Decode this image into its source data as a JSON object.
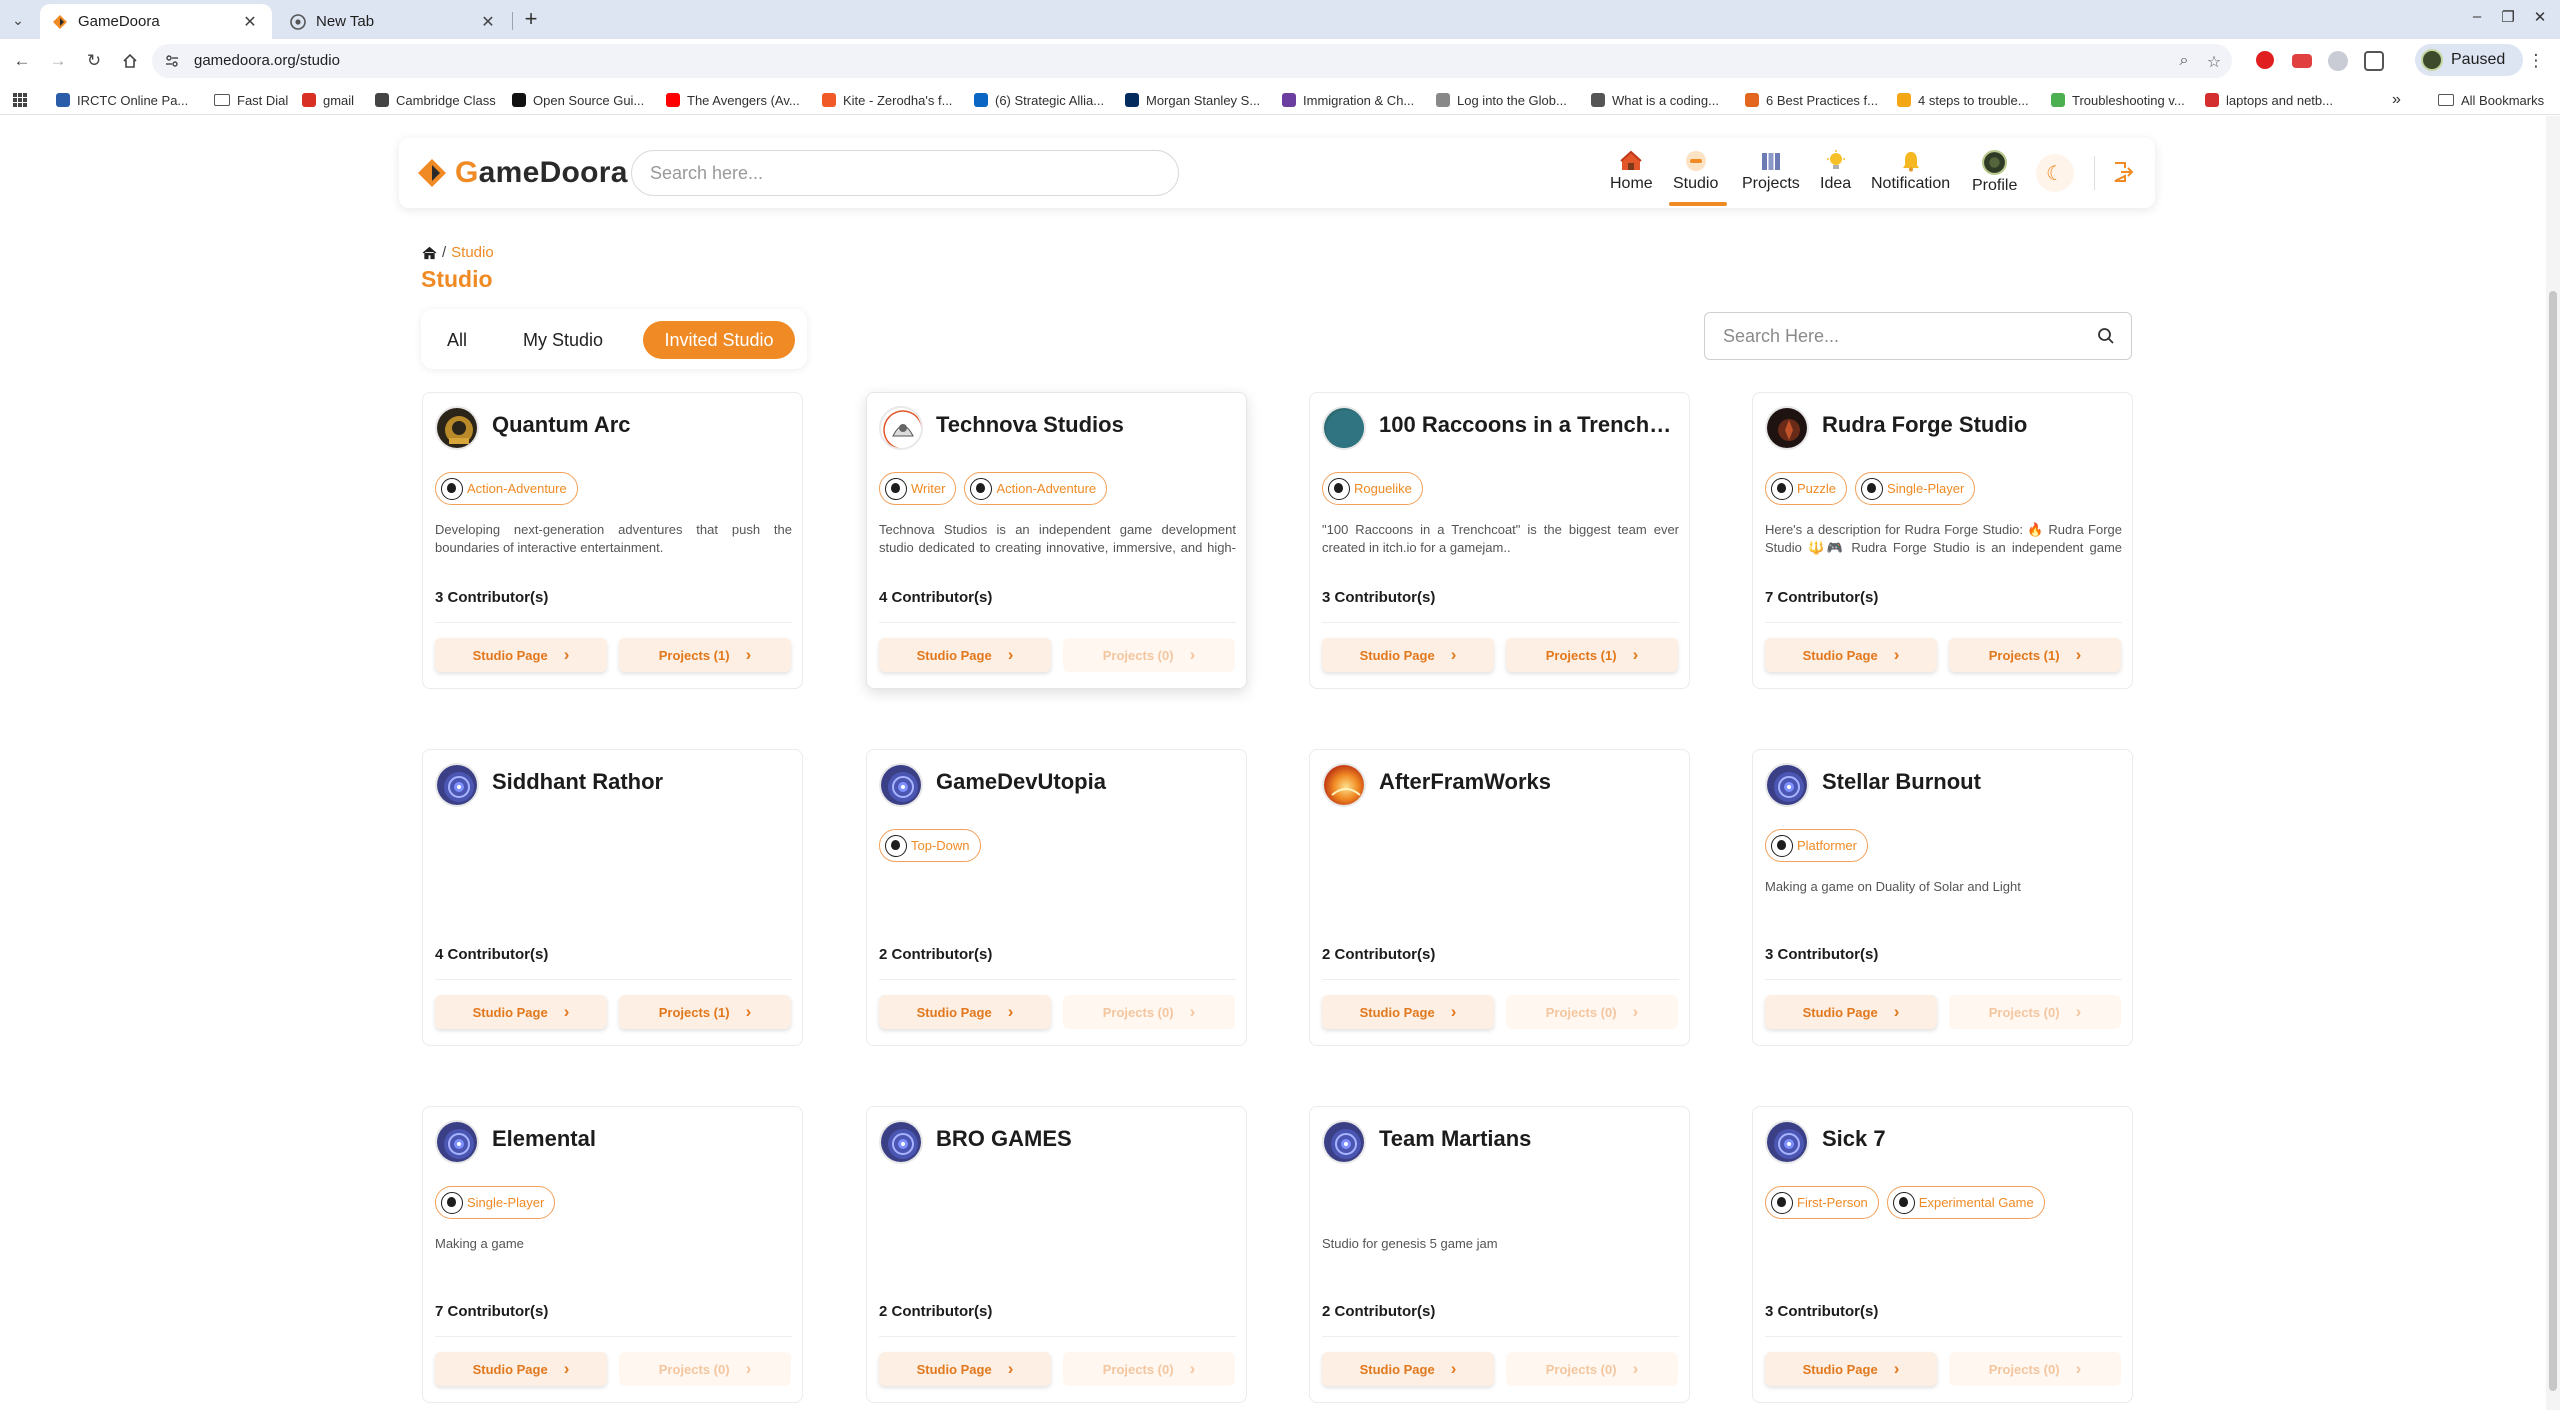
{
  "browser": {
    "tabs": [
      {
        "title": "GameDoora",
        "active": true
      },
      {
        "title": "New Tab",
        "active": false
      }
    ],
    "url": "gamedoora.org/studio",
    "profile_status": "Paused",
    "bookmarks": [
      {
        "label": "IRCTC Online Pa...",
        "color": "#2a5caa"
      },
      {
        "label": "Fast Dial",
        "folder": true
      },
      {
        "label": "gmail",
        "color": "#d93025"
      },
      {
        "label": "Cambridge Class",
        "color": "#444444"
      },
      {
        "label": "Open Source Gui...",
        "color": "#111111"
      },
      {
        "label": "The Avengers (Av...",
        "color": "#ff0000"
      },
      {
        "label": "Kite - Zerodha's f...",
        "color": "#f05a28"
      },
      {
        "label": "(6) Strategic Allia...",
        "color": "#0a66c2"
      },
      {
        "label": "Morgan Stanley S...",
        "color": "#002b5c"
      },
      {
        "label": "Immigration & Ch...",
        "color": "#6b3fa0"
      },
      {
        "label": "Log into the Glob...",
        "color": "#888888"
      },
      {
        "label": "What is a coding...",
        "color": "#555555"
      },
      {
        "label": "6 Best Practices f...",
        "color": "#e2661d"
      },
      {
        "label": "4 steps to trouble...",
        "color": "#f3a712"
      },
      {
        "label": "Troubleshooting v...",
        "color": "#4caf50"
      },
      {
        "label": "laptops and netb...",
        "color": "#d32f2f"
      }
    ],
    "all_bookmarks": "All Bookmarks"
  },
  "header": {
    "logo_text_accent": "G",
    "logo_text_rest": "ameDoora",
    "search_placeholder": "Search here...",
    "nav": [
      {
        "label": "Home",
        "icon": "home-icon"
      },
      {
        "label": "Studio",
        "icon": "studio-icon",
        "active": true
      },
      {
        "label": "Projects",
        "icon": "projects-icon"
      },
      {
        "label": "Idea",
        "icon": "idea-icon"
      },
      {
        "label": "Notification",
        "icon": "notification-icon"
      },
      {
        "label": "Profile",
        "icon": "profile-icon"
      }
    ]
  },
  "breadcrumb": {
    "separator": "/",
    "current": "Studio"
  },
  "page_title": "Studio",
  "filters": [
    {
      "label": "All",
      "active": false
    },
    {
      "label": "My Studio",
      "active": false
    },
    {
      "label": "Invited Studio",
      "active": true
    }
  ],
  "studio_search_placeholder": "Search Here...",
  "colors": {
    "accent": "#f08a24"
  },
  "studios": [
    {
      "name": "Quantum Arc",
      "tags": [
        "Action-Adventure"
      ],
      "description": "Developing next-generation adventures that push the boundaries of interactive entertainment.",
      "contributors": "3 Contributor(s)",
      "studio_page": "Studio Page",
      "projects": "Projects (1)",
      "projects_enabled": true,
      "avatar": "dark-gold"
    },
    {
      "name": "Technova Studios",
      "tags": [
        "Writer",
        "Action-Adventure"
      ],
      "description": "Technova Studios is an independent game development studio dedicated to creating innovative, immersive, and high-quality gaming experiences for players around the worl...",
      "contributors": "4 Contributor(s)",
      "studio_page": "Studio Page",
      "projects": "Projects (0)",
      "projects_enabled": false,
      "avatar": "white-sketch"
    },
    {
      "name": "100 Raccoons in a Trenchc...",
      "tags": [
        "Roguelike"
      ],
      "description": "\"100 Raccoons in a Trenchcoat\" is the biggest team ever created in itch.io for a gamejam..",
      "contributors": "3 Contributor(s)",
      "studio_page": "Studio Page",
      "projects": "Projects (1)",
      "projects_enabled": true,
      "avatar": "teal"
    },
    {
      "name": "Rudra Forge Studio",
      "tags": [
        "Puzzle",
        "Single-Player"
      ],
      "description": "Here's a description for Rudra Forge Studio: 🔥 Rudra Forge Studio 🔱🎮 Rudra Forge Studio is an independent game development studio inspired by the power, creativity, a...",
      "contributors": "7 Contributor(s)",
      "studio_page": "Studio Page",
      "projects": "Projects (1)",
      "projects_enabled": true,
      "avatar": "dark-red"
    },
    {
      "name": "Siddhant Rathor",
      "tags": [],
      "description": "",
      "contributors": "4 Contributor(s)",
      "studio_page": "Studio Page",
      "projects": "Projects (1)",
      "projects_enabled": true,
      "avatar": "default"
    },
    {
      "name": "GameDevUtopia",
      "tags": [
        "Top-Down"
      ],
      "description": "",
      "contributors": "2 Contributor(s)",
      "studio_page": "Studio Page",
      "projects": "Projects (0)",
      "projects_enabled": false,
      "avatar": "default"
    },
    {
      "name": "AfterFramWorks",
      "tags": [],
      "description": "",
      "contributors": "2 Contributor(s)",
      "studio_page": "Studio Page",
      "projects": "Projects (0)",
      "projects_enabled": false,
      "avatar": "fire"
    },
    {
      "name": "Stellar Burnout",
      "tags": [
        "Platformer"
      ],
      "description": "Making a game on Duality of Solar and Light",
      "contributors": "3 Contributor(s)",
      "studio_page": "Studio Page",
      "projects": "Projects (0)",
      "projects_enabled": false,
      "avatar": "default"
    },
    {
      "name": "Elemental",
      "tags": [
        "Single-Player"
      ],
      "description": "Making a game",
      "contributors": "7 Contributor(s)",
      "studio_page": "Studio Page",
      "projects": "Projects (0)",
      "projects_enabled": false,
      "avatar": "default"
    },
    {
      "name": "BRO GAMES",
      "tags": [],
      "description": "",
      "contributors": "2 Contributor(s)",
      "studio_page": "Studio Page",
      "projects": "Projects (0)",
      "projects_enabled": false,
      "avatar": "default"
    },
    {
      "name": "Team Martians",
      "tags": [],
      "description": "Studio for genesis 5 game jam",
      "contributors": "2 Contributor(s)",
      "studio_page": "Studio Page",
      "projects": "Projects (0)",
      "projects_enabled": false,
      "avatar": "default"
    },
    {
      "name": "Sick 7",
      "tags": [
        "First-Person",
        "Experimental Game"
      ],
      "description": "",
      "contributors": "3 Contributor(s)",
      "studio_page": "Studio Page",
      "projects": "Projects (0)",
      "projects_enabled": false,
      "avatar": "default"
    }
  ]
}
